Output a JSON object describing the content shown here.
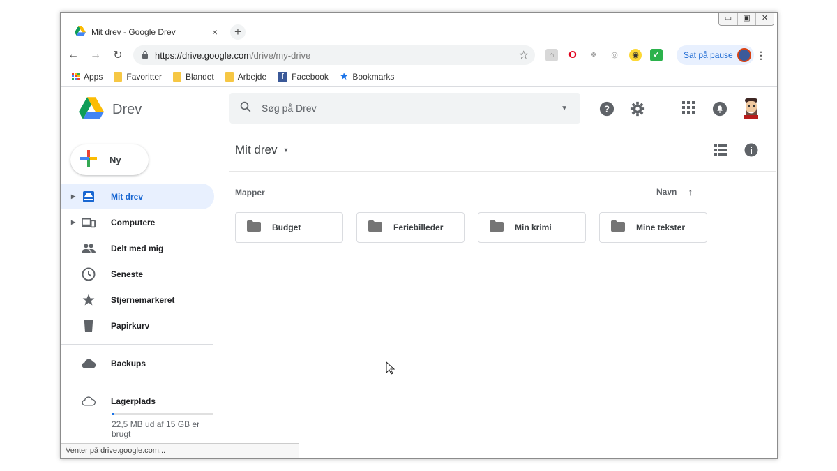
{
  "window": {
    "tab_title": "Mit drev - Google Drev",
    "tab_close": "×",
    "new_tab": "+",
    "controls": {
      "minimize": "▭",
      "maximize": "▣",
      "close": "✕"
    }
  },
  "toolbar": {
    "back": "←",
    "forward": "→",
    "reload": "↻",
    "url_host": "https://drive.google.com",
    "url_path": "/drive/my-drive",
    "bookmark_star": "☆",
    "profile_label": "Sat på pause",
    "menu": "⋮"
  },
  "bookmarks": [
    {
      "label": "Apps",
      "icon": "apps-grid-icon"
    },
    {
      "label": "Favoritter",
      "icon": "folder-icon"
    },
    {
      "label": "Blandet",
      "icon": "folder-icon"
    },
    {
      "label": "Arbejde",
      "icon": "folder-icon"
    },
    {
      "label": "Facebook",
      "icon": "facebook-icon"
    },
    {
      "label": "Bookmarks",
      "icon": "star-icon"
    }
  ],
  "drive": {
    "logo_text": "Drev",
    "search_placeholder": "Søg på Drev",
    "new_button": "Ny",
    "nav": [
      {
        "label": "Mit drev",
        "icon": "my-drive-icon",
        "active": true,
        "expandable": true
      },
      {
        "label": "Computere",
        "icon": "computers-icon",
        "active": false,
        "expandable": true
      },
      {
        "label": "Delt med mig",
        "icon": "shared-icon",
        "active": false
      },
      {
        "label": "Seneste",
        "icon": "recent-icon",
        "active": false
      },
      {
        "label": "Stjernemarkeret",
        "icon": "starred-icon",
        "active": false
      },
      {
        "label": "Papirkurv",
        "icon": "trash-icon",
        "active": false
      }
    ],
    "backups_label": "Backups",
    "storage_label": "Lagerplads",
    "storage_text": "22,5 MB ud af 15 GB er brugt",
    "storage_fraction": 0.0015,
    "breadcrumb": "Mit drev",
    "section_folders": "Mapper",
    "sort_label": "Navn",
    "folders": [
      "Budget",
      "Feriebilleder",
      "Min krimi",
      "Mine tekster"
    ]
  },
  "status_bar": "Venter på drive.google.com...",
  "colors": {
    "accent": "#1967d2",
    "active_bg": "#e8f0fe",
    "icon_gray": "#5f6368"
  }
}
